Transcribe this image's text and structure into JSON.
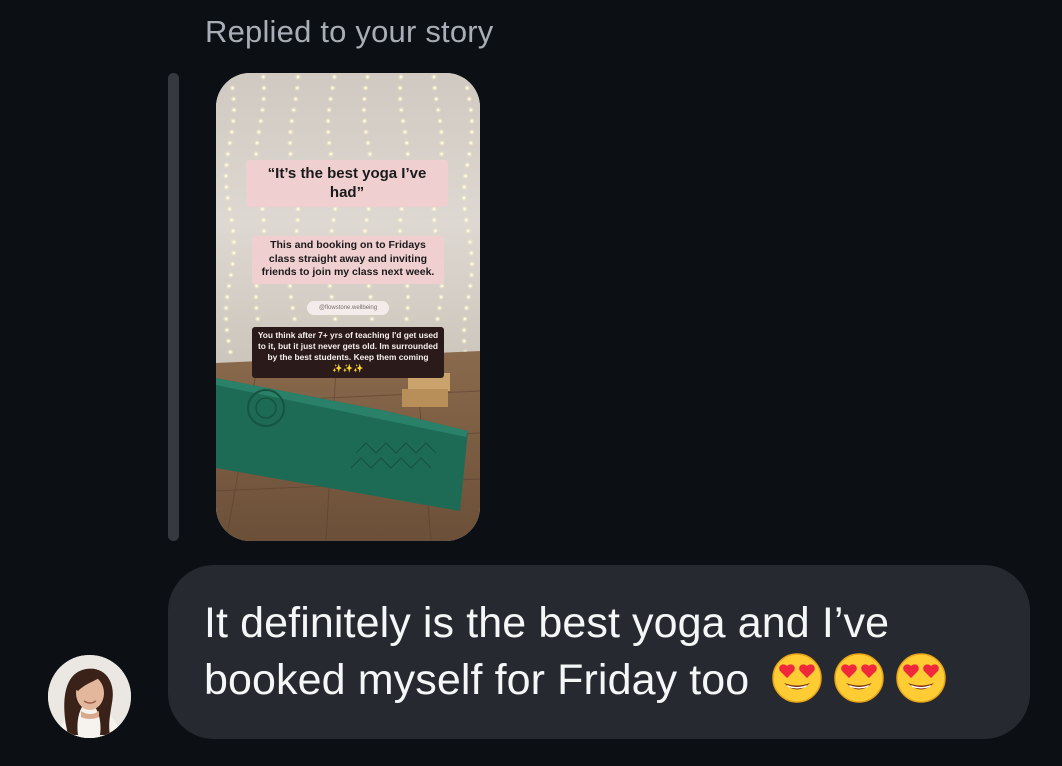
{
  "reply_header": {
    "label": "Replied to your story"
  },
  "story": {
    "quote_sticker": "“It’s the best yoga I’ve had”",
    "body_sticker": "This and booking on to Fridays class straight away and inviting friends to join my class next week.",
    "handle_sticker": "@flowstone.wellbeing",
    "caption_sticker": "You think after 7+ yrs of teaching I'd get used to it, but it just never gets old. Im surrounded by the best students. Keep them coming",
    "caption_sparkles": "✨✨✨"
  },
  "message": {
    "text": "It definitely is the best yoga and I’ve booked myself for Friday too",
    "emoji_count": 3,
    "emoji_name": "smiling-face-with-heart-eyes"
  },
  "colors": {
    "background": "#0c1014",
    "bubble": "#262a30",
    "header_text": "#a8aeb6",
    "message_text": "#f5f6f7",
    "sticker_pink": "#f0cfd0",
    "yoga_mat": "#1d6b55"
  }
}
